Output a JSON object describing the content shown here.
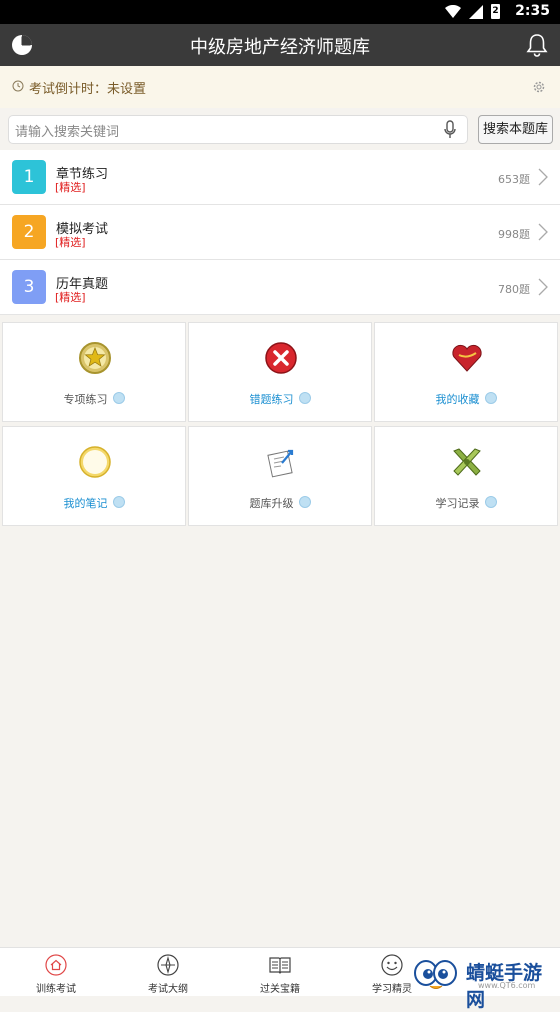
{
  "status_bar": {
    "time": "2:35",
    "battery_digit": "2"
  },
  "app_bar": {
    "title": "中级房地产经济师题库",
    "left_icon": "pie-chart-icon",
    "right_icon": "bell-icon"
  },
  "countdown": {
    "text": "考试倒计时：未设置",
    "clock_icon": "clock-icon",
    "settings_icon": "gear-icon"
  },
  "search": {
    "placeholder": "请输入搜索关键词",
    "button_label": "搜索本题库",
    "mic_icon": "microphone-icon"
  },
  "sections": [
    {
      "number": "1",
      "name": "章节练习",
      "tag": "[精选]",
      "count": "653题",
      "color": "#2dc3d8"
    },
    {
      "number": "2",
      "name": "模拟考试",
      "tag": "[精选]",
      "count": "998题",
      "color": "#f6a623"
    },
    {
      "number": "3",
      "name": "历年真题",
      "tag": "[精选]",
      "count": "780题",
      "color": "#7f9ef5"
    }
  ],
  "features": [
    {
      "label": "专项练习",
      "icon": "star-medal-icon",
      "label_color": "#555555"
    },
    {
      "label": "错题练习",
      "icon": "red-x-icon",
      "label_color": "#1b8fd1"
    },
    {
      "label": "我的收藏",
      "icon": "heart-icon",
      "label_color": "#1b8fd1"
    },
    {
      "label": "我的笔记",
      "icon": "note-pad-icon",
      "label_color": "#1b8fd1"
    },
    {
      "label": "题库升级",
      "icon": "upgrade-icon",
      "label_color": "#555555"
    },
    {
      "label": "学习记录",
      "icon": "tools-icon",
      "label_color": "#555555"
    }
  ],
  "tabs": [
    {
      "label": "训练考试",
      "icon": "home-icon"
    },
    {
      "label": "考试大纲",
      "icon": "compass-icon"
    },
    {
      "label": "过关宝籍",
      "icon": "book-icon"
    },
    {
      "label": "学习精灵",
      "icon": "smiley-icon"
    }
  ],
  "watermark": {
    "title": "蜻蜓手游网",
    "url": "www.QT6.com"
  }
}
